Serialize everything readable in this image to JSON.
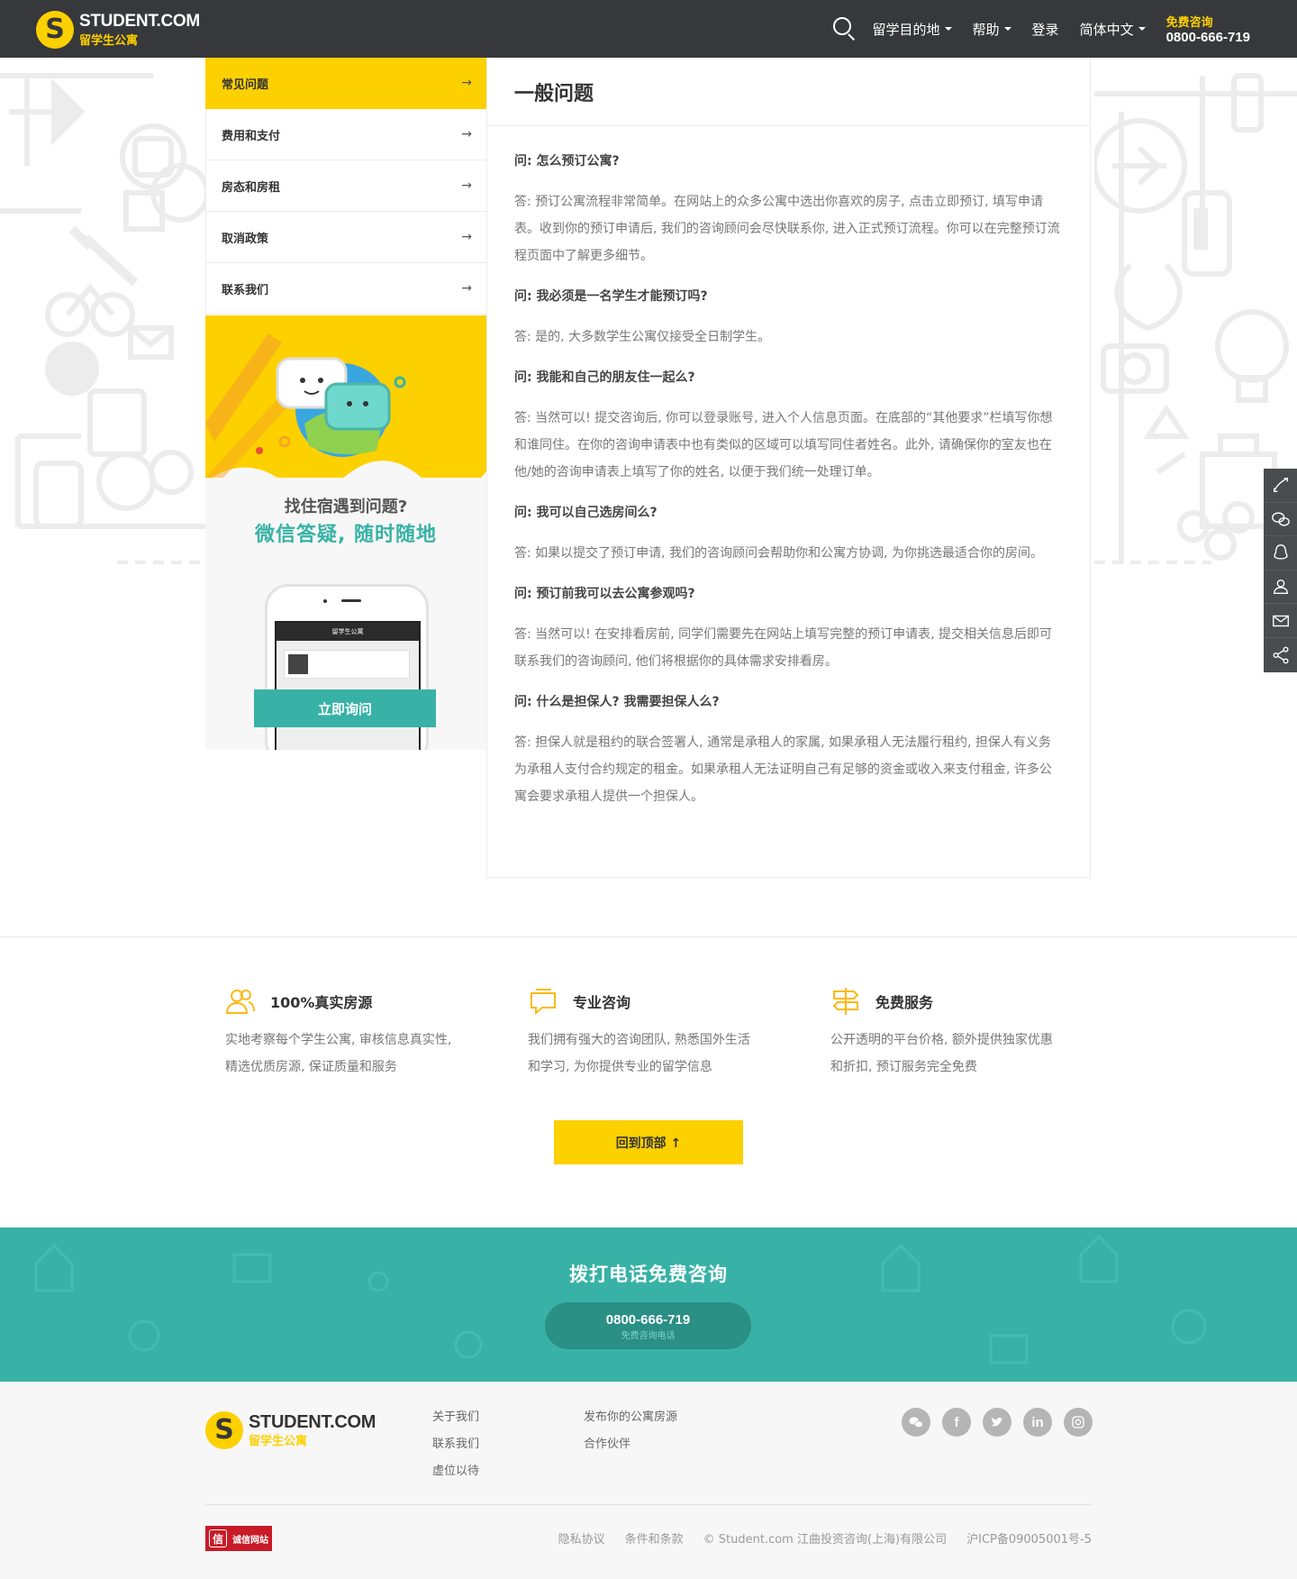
{
  "header": {
    "logo_text": "STUDENT.COM",
    "logo_sub": "留学生公寓",
    "nav": [
      {
        "label": "留学目的地",
        "dropdown": true
      },
      {
        "label": "帮助",
        "dropdown": true
      },
      {
        "label": "登录",
        "dropdown": false
      },
      {
        "label": "简体中文",
        "dropdown": true
      }
    ],
    "phone_label": "免费咨询",
    "phone_number": "0800-666-719"
  },
  "sidebar": {
    "items": [
      {
        "label": "常见问题",
        "arrow": "→",
        "active": true
      },
      {
        "label": "费用和支付",
        "arrow": "→",
        "active": false
      },
      {
        "label": "房态和房租",
        "arrow": "→",
        "active": false
      },
      {
        "label": "取消政策",
        "arrow": "→",
        "active": false
      },
      {
        "label": "联系我们",
        "arrow": "→",
        "active": false
      }
    ]
  },
  "promo": {
    "question": "找住宿遇到问题?",
    "headline": "微信答疑, 随时随地",
    "screen_title": "留学生公寓",
    "button": "立即询问"
  },
  "content": {
    "title": "一般问题",
    "qa": [
      {
        "q": "问: 怎么预订公寓?",
        "a": "答: 预订公寓流程非常简单。在网站上的众多公寓中选出你喜欢的房子, 点击立即预订, 填写申请表。收到你的预订申请后, 我们的咨询顾问会尽快联系你, 进入正式预订流程。你可以在完整预订流程页面中了解更多细节。"
      },
      {
        "q": "问: 我必须是一名学生才能预订吗?",
        "a": "答: 是的, 大多数学生公寓仅接受全日制学生。"
      },
      {
        "q": "问: 我能和自己的朋友住一起么?",
        "a": "答: 当然可以! 提交咨询后, 你可以登录账号, 进入个人信息页面。在底部的“其他要求”栏填写你想和谁同住。在你的咨询申请表中也有类似的区域可以填写同住者姓名。此外, 请确保你的室友也在他/她的咨询申请表上填写了你的姓名, 以便于我们统一处理订单。"
      },
      {
        "q": "问: 我可以自己选房间么?",
        "a": "答: 如果以提交了预订申请, 我们的咨询顾问会帮助你和公寓方协调, 为你挑选最适合你的房间。"
      },
      {
        "q": "问: 预订前我可以去公寓参观吗?",
        "a": "答: 当然可以! 在安排看房前, 同学们需要先在网站上填写完整的预订申请表, 提交相关信息后即可联系我们的咨询顾问, 他们将根据你的具体需求安排看房。"
      },
      {
        "q": "问: 什么是担保人? 我需要担保人么?",
        "a": "答: 担保人就是租约的联合签署人, 通常是承租人的家属, 如果承租人无法履行租约, 担保人有义务为承租人支付合约规定的租金。如果承租人无法证明自己有足够的资金或收入来支付租金, 许多公寓会要求承租人提供一个担保人。"
      }
    ]
  },
  "side_tools": [
    "phone-icon",
    "wechat-icon",
    "qq-icon",
    "user-icon",
    "mail-icon",
    "share-icon"
  ],
  "features": [
    {
      "icon": "users-icon",
      "title": "100%真实房源",
      "desc": "实地考察每个学生公寓, 审核信息真实性, 精选优质房源, 保证质量和服务"
    },
    {
      "icon": "chat-icon",
      "title": "专业咨询",
      "desc": "我们拥有强大的咨询团队, 熟悉国外生活和学习, 为你提供专业的留学信息"
    },
    {
      "icon": "signpost-icon",
      "title": "免费服务",
      "desc": "公开透明的平台价格, 额外提供独家优惠和折扣, 预订服务完全免费"
    }
  ],
  "back_to_top": "回到顶部 ↑",
  "call": {
    "title": "拨打电话免费咨询",
    "number": "0800-666-719",
    "sub": "免费咨询电话"
  },
  "footer": {
    "logo_text": "STUDENT.COM",
    "logo_sub": "留学生公寓",
    "col1": [
      "关于我们",
      "联系我们",
      "虚位以待"
    ],
    "col2": [
      "发布你的公寓房源",
      "合作伙伴"
    ],
    "socials": [
      "wechat-icon",
      "facebook-icon",
      "twitter-icon",
      "linkedin-icon",
      "instagram-icon"
    ],
    "trust_badge": "诚信网站",
    "trust_mark": "信",
    "legal": [
      "隐私协议",
      "条件和条款",
      "© Student.com 江曲投资咨询(上海)有限公司",
      "沪ICP备09005001号-5"
    ]
  },
  "colors": {
    "brand_yellow": "#fdd000",
    "header_dark": "#37383b",
    "teal": "#38b2a6"
  }
}
